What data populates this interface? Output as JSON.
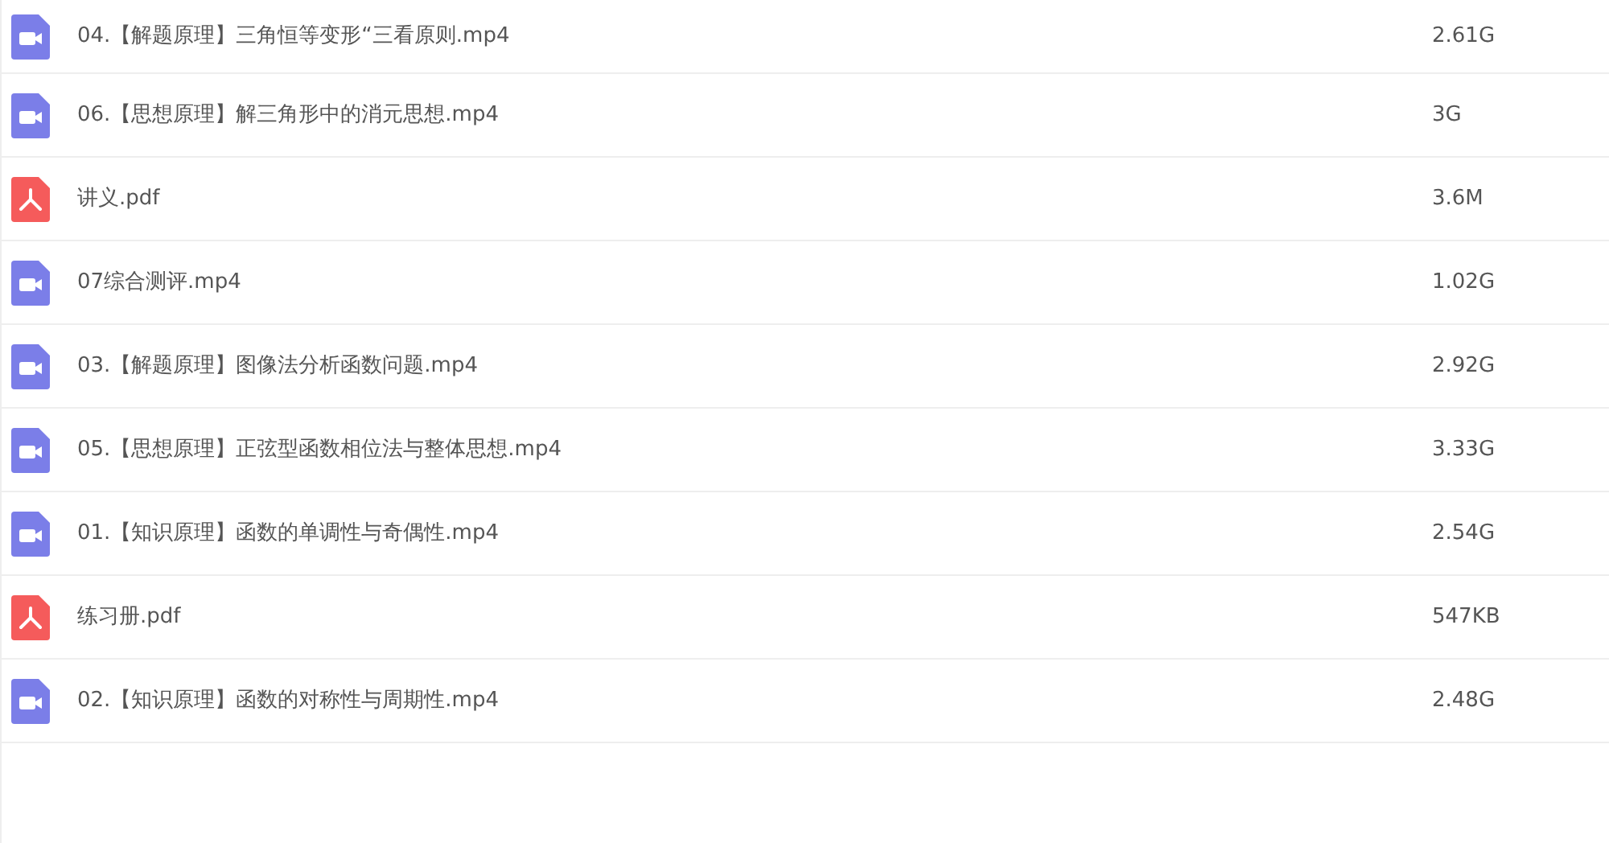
{
  "files": [
    {
      "kind": "video",
      "name": "04.【解题原理】三角恒等变形“三看原则.mp4",
      "size": "2.61G"
    },
    {
      "kind": "video",
      "name": "06.【思想原理】解三角形中的消元思想.mp4",
      "size": "3G"
    },
    {
      "kind": "pdf",
      "name": "讲义.pdf",
      "size": "3.6M"
    },
    {
      "kind": "video",
      "name": "07综合测评.mp4",
      "size": "1.02G"
    },
    {
      "kind": "video",
      "name": "03.【解题原理】图像法分析函数问题.mp4",
      "size": "2.92G"
    },
    {
      "kind": "video",
      "name": "05.【思想原理】正弦型函数相位法与整体思想.mp4",
      "size": "3.33G"
    },
    {
      "kind": "video",
      "name": "01.【知识原理】函数的单调性与奇偶性.mp4",
      "size": "2.54G"
    },
    {
      "kind": "pdf",
      "name": "练习册.pdf",
      "size": "547KB"
    },
    {
      "kind": "video",
      "name": "02.【知识原理】函数的对称性与周期性.mp4",
      "size": "2.48G"
    }
  ]
}
